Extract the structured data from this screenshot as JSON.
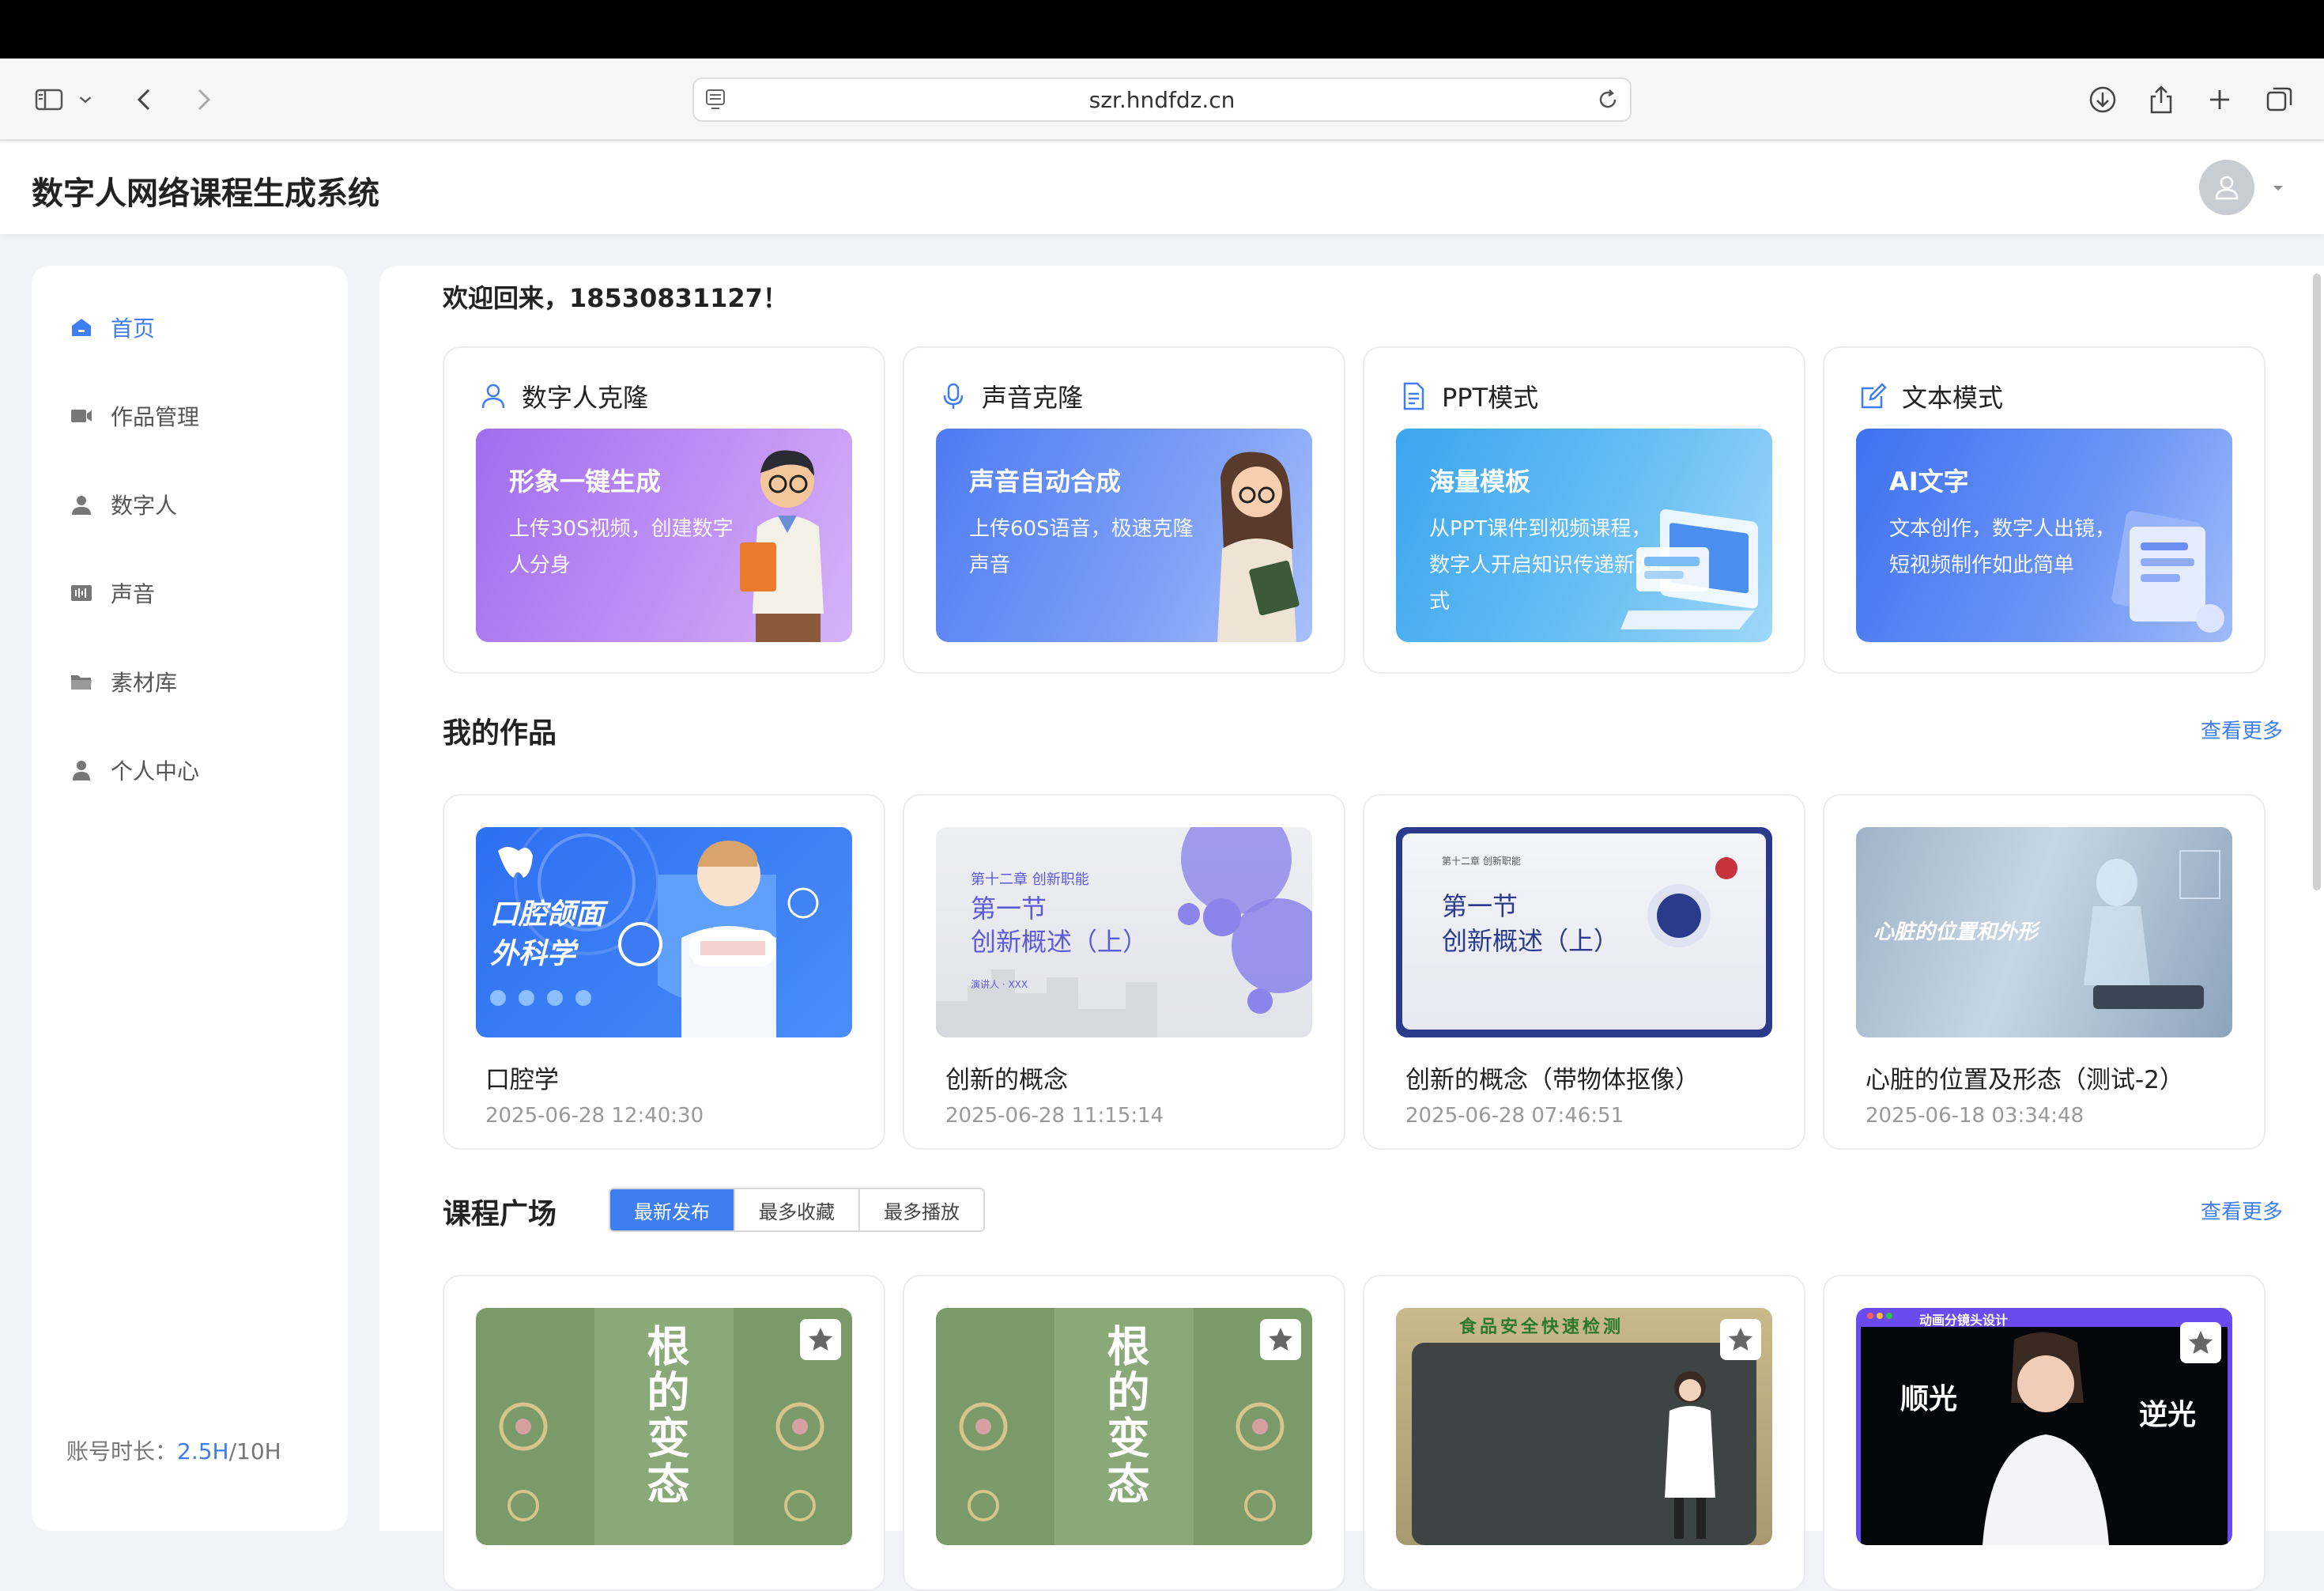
{
  "browser": {
    "url": "szr.hndfdz.cn"
  },
  "app": {
    "title": "数字人网络课程生成系统"
  },
  "sidebar": {
    "items": [
      {
        "label": "首页",
        "icon": "home-icon",
        "active": true
      },
      {
        "label": "作品管理",
        "icon": "video-camera-icon"
      },
      {
        "label": "数字人",
        "icon": "person-icon"
      },
      {
        "label": "声音",
        "icon": "audio-wave-icon"
      },
      {
        "label": "素材库",
        "icon": "folder-icon"
      },
      {
        "label": "个人中心",
        "icon": "user-icon"
      }
    ],
    "account_label": "账号时长：",
    "account_used": "2.5H",
    "account_total": "/10H"
  },
  "main": {
    "welcome": "欢迎回来，18530831127！",
    "features": [
      {
        "label": "数字人克隆",
        "icon": "person-outline-icon",
        "banner_title": "形象一键生成",
        "banner_desc": "上传30S视频，创建数字人分身"
      },
      {
        "label": "声音克隆",
        "icon": "microphone-icon",
        "banner_title": "声音自动合成",
        "banner_desc": "上传60S语音，极速克隆声音"
      },
      {
        "label": "PPT模式",
        "icon": "document-icon",
        "banner_title": "海量模板",
        "banner_desc": "从PPT课件到视频课程，数字人开启知识传递新方式"
      },
      {
        "label": "文本模式",
        "icon": "edit-icon",
        "banner_title": "AI文字",
        "banner_desc": "文本创作，数字人出镜，短视频制作如此简单"
      }
    ],
    "works": {
      "title": "我的作品",
      "more": "查看更多",
      "items": [
        {
          "name": "口腔学",
          "date": "2025-06-28 12:40:30",
          "thumb_text_1": "口腔颌面",
          "thumb_text_2": "外科学"
        },
        {
          "name": "创新的概念",
          "date": "2025-06-28 11:15:14",
          "thumb_chapter": "第十二章  创新职能",
          "thumb_text_1": "第一节",
          "thumb_text_2": "创新概述（上）",
          "thumb_small": "演讲人 · XXX"
        },
        {
          "name": "创新的概念（带物体抠像）",
          "date": "2025-06-28 07:46:51",
          "thumb_chapter": "第十二章 创新职能",
          "thumb_text_1": "第一节",
          "thumb_text_2": "创新概述（上）"
        },
        {
          "name": "心脏的位置及形态（测试-2）",
          "date": "2025-06-18 03:34:48",
          "thumb_text_1": "心脏的位置和外形"
        }
      ]
    },
    "plaza": {
      "title": "课程广场",
      "more": "查看更多",
      "tabs": [
        {
          "label": "最新发布",
          "active": true
        },
        {
          "label": "最多收藏"
        },
        {
          "label": "最多播放"
        }
      ],
      "items": [
        {
          "thumb_text": "根的变态"
        },
        {
          "thumb_text": "根的变态"
        },
        {
          "thumb_text": "食品安全快速检测"
        },
        {
          "thumb_text_1": "顺光",
          "thumb_text_2": "逆光",
          "thumb_header": "动画分镜头设计"
        }
      ]
    }
  },
  "colors": {
    "accent": "#3f7ef1"
  }
}
